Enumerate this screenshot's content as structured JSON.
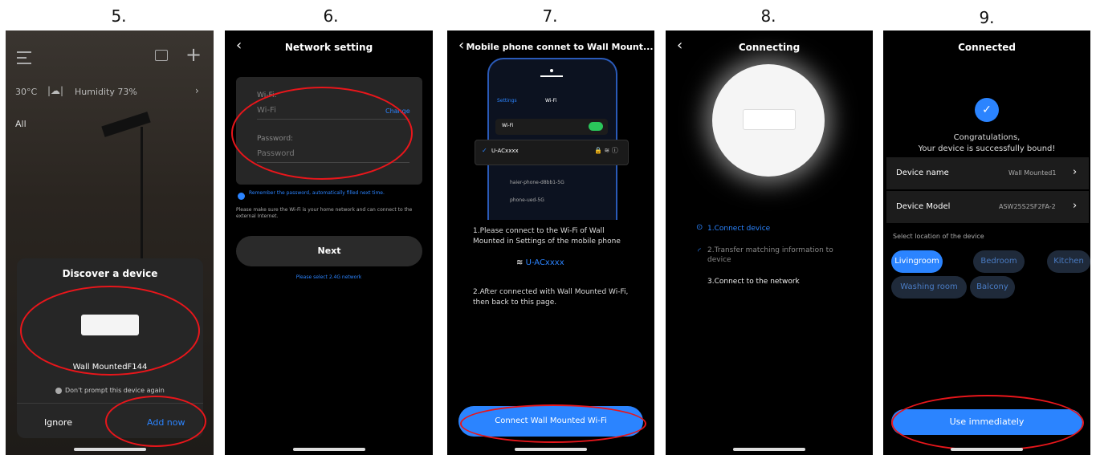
{
  "steps": [
    "5.",
    "6.",
    "7.",
    "8.",
    "9."
  ],
  "s5": {
    "weather": "30°C",
    "humidity": "Humidity 73%",
    "tab_all": "All",
    "modal_title": "Discover a device",
    "device_name": "Wall MountedF144",
    "checkbox_label": "Don't prompt this device again",
    "ignore": "Ignore",
    "add_now": "Add now"
  },
  "s6": {
    "title": "Network setting",
    "wifi_label": "Wi-Fi:",
    "wifi_placeholder": "Wi-Fi",
    "change": "Change",
    "password_label": "Password:",
    "password_placeholder": "Password",
    "remember": "Remember the password, automatically filled next time.",
    "note": "Please make sure the Wi-Fi is your home network and can connect to the external Internet.",
    "next": "Next",
    "support": "Please select 2.4G network"
  },
  "s7": {
    "title": "Mobile phone connet to Wall Mount...",
    "mock_settings": "Settings",
    "mock_wifi": "Wi-Fi",
    "mock_wifi_row": "Wi-Fi",
    "mock_selected": "U-ACxxxx",
    "mock_net1": "haier-phone-d8bb1-5G",
    "mock_net2": "phone-ued-5G",
    "instr1": "1.Please connect to the Wi-Fi of Wall Mounted in Settings of the mobile phone",
    "ssid": "U-ACxxxx",
    "instr2": "2.After connected with Wall Mounted Wi-Fi, then back to this page.",
    "button": "Connect Wall Mounted Wi-Fi"
  },
  "s8": {
    "title": "Connecting",
    "step1": "1.Connect device",
    "step2": "2.Transfer matching information to device",
    "step3": "3.Connect to the network"
  },
  "s9": {
    "title": "Connected",
    "congrats1": "Congratulations,",
    "congrats2": "Your device is successfully bound!",
    "name_label": "Device name",
    "name_value": "Wall Mounted1",
    "model_label": "Device Model",
    "model_value": "ASW25S2SF2FA-2",
    "location_label": "Select location of the device",
    "rooms": [
      "Livingroom",
      "Bedroom",
      "Kitchen",
      "Washing room",
      "Balcony"
    ],
    "button": "Use immediately"
  },
  "colors": {
    "accent": "#2b84ff",
    "annotation": "#e8161b",
    "panel": "#262626"
  }
}
